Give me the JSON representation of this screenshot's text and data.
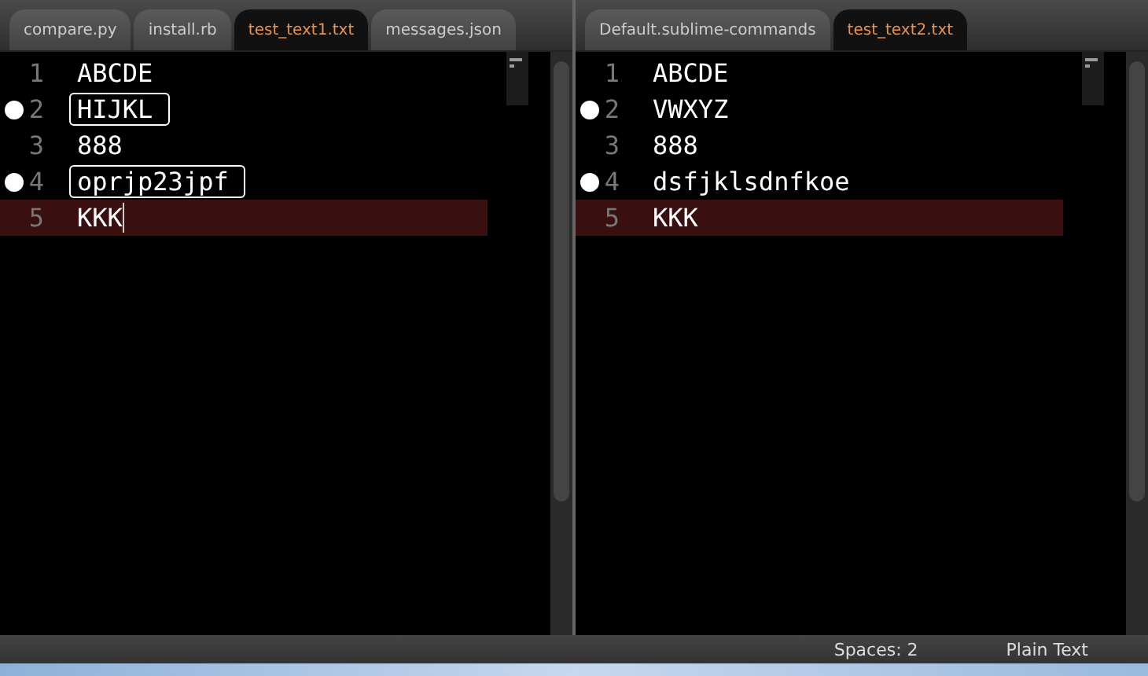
{
  "panes": [
    {
      "tabs": [
        {
          "label": "compare.py",
          "selected": false
        },
        {
          "label": "install.rb",
          "selected": false
        },
        {
          "label": "test_text1.txt",
          "selected": true
        },
        {
          "label": "messages.json",
          "selected": false
        }
      ],
      "lines": [
        {
          "number": "1",
          "text": "ABCDE",
          "marked": false,
          "boxed": false,
          "current": false,
          "cursor": false
        },
        {
          "number": "2",
          "text": "HIJKL",
          "marked": true,
          "boxed": true,
          "current": false,
          "cursor": false
        },
        {
          "number": "3",
          "text": "888",
          "marked": false,
          "boxed": false,
          "current": false,
          "cursor": false
        },
        {
          "number": "4",
          "text": "oprjp23jpf",
          "marked": true,
          "boxed": true,
          "current": false,
          "cursor": false
        },
        {
          "number": "5",
          "text": "KKK",
          "marked": false,
          "boxed": false,
          "current": true,
          "cursor": true
        }
      ]
    },
    {
      "tabs": [
        {
          "label": "Default.sublime-commands",
          "selected": false
        },
        {
          "label": "test_text2.txt",
          "selected": true
        }
      ],
      "lines": [
        {
          "number": "1",
          "text": "ABCDE",
          "marked": false,
          "boxed": false,
          "current": false,
          "cursor": false
        },
        {
          "number": "2",
          "text": "VWXYZ",
          "marked": true,
          "boxed": false,
          "current": false,
          "cursor": false
        },
        {
          "number": "3",
          "text": "888",
          "marked": false,
          "boxed": false,
          "current": false,
          "cursor": false
        },
        {
          "number": "4",
          "text": "dsfjklsdnfkoe",
          "marked": true,
          "boxed": false,
          "current": false,
          "cursor": false
        },
        {
          "number": "5",
          "text": "KKK",
          "marked": false,
          "boxed": false,
          "current": true,
          "cursor": false
        }
      ]
    }
  ],
  "status_bar": {
    "indentation": "Spaces: 2",
    "syntax": "Plain Text"
  }
}
